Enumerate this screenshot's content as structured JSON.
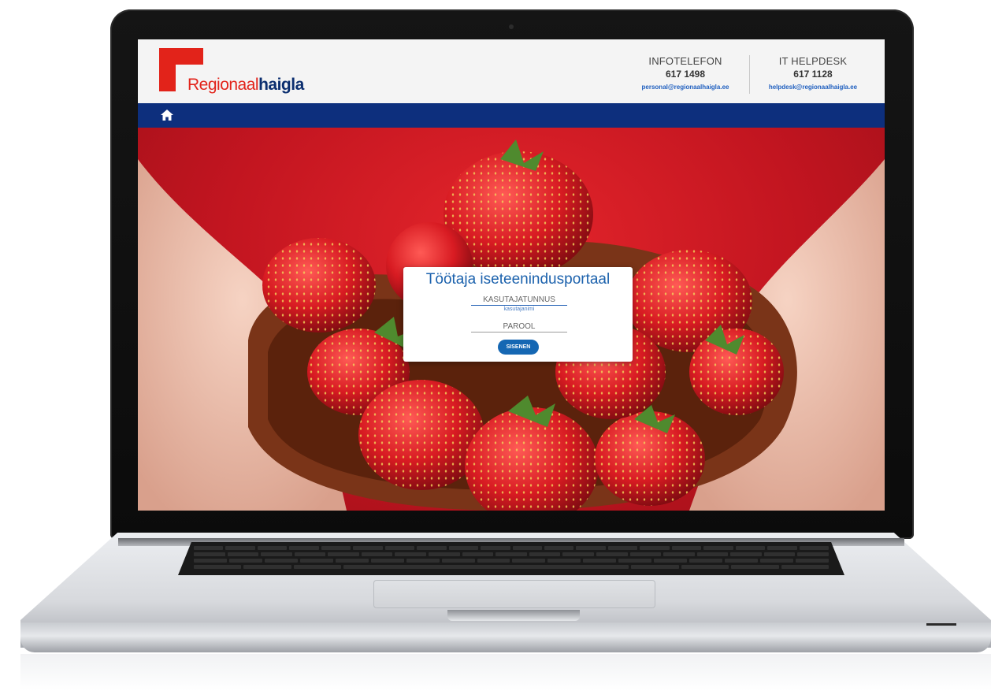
{
  "header": {
    "logo": {
      "text_part1": "Regionaal",
      "text_part2": "haigla",
      "colors": {
        "red": "#e2231a",
        "blue": "#0b2e6f"
      }
    },
    "contacts": [
      {
        "title": "INFOTELEFON",
        "phone": "617 1498",
        "email": "personal@regionaalhaigla.ee"
      },
      {
        "title": "IT HELPDESK",
        "phone": "617 1128",
        "email": "helpdesk@regionaalhaigla.ee"
      }
    ]
  },
  "nav": {
    "home_icon": "home-icon",
    "color": "#0d2f7d"
  },
  "hero": {
    "background_image": "strawberries in wooden heart-shaped bowl held by hands"
  },
  "login": {
    "title": "Töötaja iseteenindusportaal",
    "username_placeholder": "KASUTAJATUNNUS",
    "username_hint": "kasutajanimi",
    "password_placeholder": "PAROOL",
    "submit_label": "SISENEN"
  }
}
